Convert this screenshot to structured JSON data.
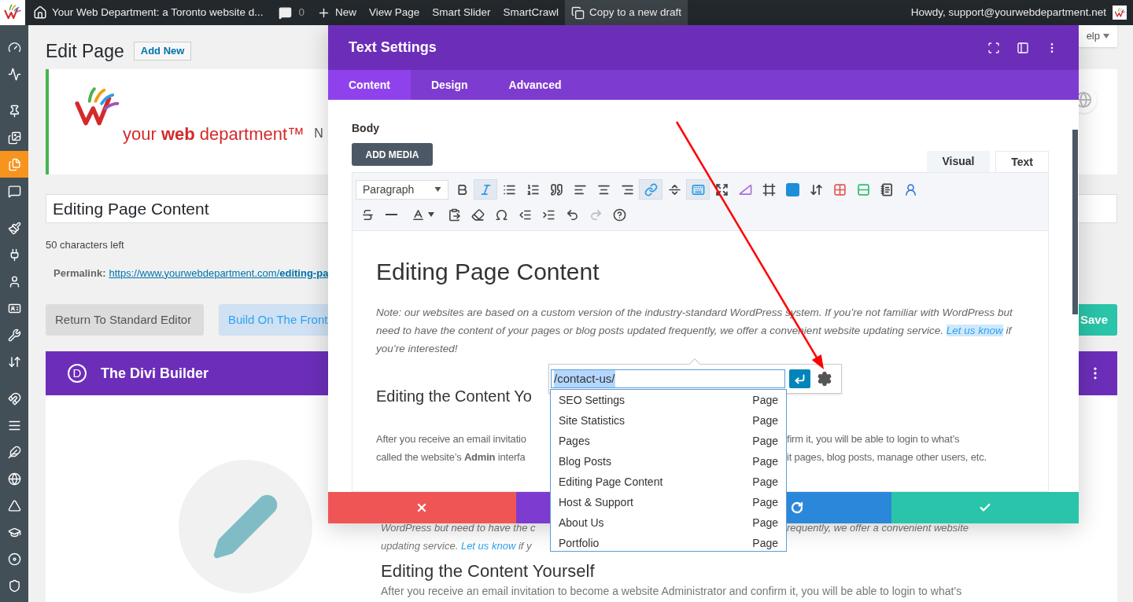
{
  "admin_bar": {
    "site_title": "Your Web Department: a Toronto website d...",
    "comments": "0",
    "items": [
      {
        "kind": "new",
        "label": "New"
      },
      {
        "kind": "link",
        "label": "View Page"
      },
      {
        "kind": "link",
        "label": "Smart Slider"
      },
      {
        "kind": "link",
        "label": "SmartCrawl"
      },
      {
        "kind": "copy",
        "label": "Copy to a new draft"
      }
    ],
    "greeting": "Howdy, support@yourwebdepartment.net"
  },
  "sidebar": {
    "items": [
      {
        "selected": false
      },
      {
        "selected": false
      },
      {
        "selected": false
      },
      {
        "selected": false
      },
      {
        "selected": true
      },
      {
        "selected": false
      },
      {
        "selected": false
      },
      {
        "selected": false
      },
      {
        "selected": false
      },
      {
        "selected": false
      },
      {
        "selected": false
      },
      {
        "selected": false
      },
      {
        "selected": false
      },
      {
        "selected": false
      },
      {
        "selected": false
      },
      {
        "selected": false
      },
      {
        "selected": false
      },
      {
        "selected": false
      },
      {
        "selected": false
      },
      {
        "selected": false
      }
    ]
  },
  "page": {
    "title": "Edit Page",
    "add_new": "Add New",
    "help_tab": "elp",
    "logo_text": "your **web** department™",
    "notice_cut_text": "N",
    "post_title": "Editing Page Content",
    "chars_left": "50 characters left",
    "permalink_label": "Permalink:",
    "permalink_url": "https://www.yourwebdepartment.com/**editing-pa**",
    "buttons": [
      {
        "kind": "default",
        "label": "Return To Standard Editor"
      },
      {
        "kind": "primary",
        "label": "Build On The Front"
      }
    ],
    "save": "Save",
    "builder_logo": "D",
    "builder_title": "The Divi Builder",
    "preview": {
      "line_1_left": "WordPress but need to have the c",
      "line_1_right": "requently, we offer a convenient website",
      "line_2_text": "updating service.",
      "line_2_link": "Let us know",
      "line_2_after": "if y",
      "heading": "Editing the Content Yourself",
      "paragraph": "After you receive an email invitation to become a website Administrator and confirm it, you will be able to login to what’s"
    }
  },
  "modal": {
    "title": "Text Settings",
    "tabs": [
      {
        "label": "Content",
        "selected": true
      },
      {
        "label": "Design",
        "selected": false
      },
      {
        "label": "Advanced",
        "selected": false
      }
    ],
    "field_label": "Body",
    "add_media": "ADD MEDIA",
    "editor_tabs": [
      {
        "label": "Visual",
        "selected": true
      },
      {
        "label": "Text",
        "selected": false
      }
    ],
    "format_select": "Paragraph",
    "toolbar_row_1": [
      {
        "active": false
      },
      {
        "active": true
      },
      {
        "active": false
      },
      {
        "active": false
      },
      {
        "active": false
      },
      {
        "active": false
      },
      {
        "active": false
      },
      {
        "active": false
      },
      {
        "active": true
      },
      {
        "active": false
      },
      {
        "active": true
      },
      {
        "active": false
      },
      {
        "active": false
      },
      {
        "active": false
      },
      {
        "active": false
      },
      {
        "active": false
      },
      {
        "active": false
      },
      {
        "active": false
      },
      {
        "active": false
      },
      {
        "active": false
      }
    ],
    "toolbar_row_2": [
      {
        "disabled": false
      },
      {
        "disabled": false
      },
      {
        "disabled": false
      },
      {
        "disabled": false
      },
      {
        "disabled": false
      },
      {
        "disabled": false
      },
      {
        "disabled": false
      },
      {
        "disabled": false
      },
      {
        "disabled": false
      },
      {
        "disabled": true
      },
      {
        "disabled": false
      }
    ],
    "content": {
      "heading": "Editing Page Content",
      "note": {
        "before": "Note: our websites are based on a custom version of the industry-standard WordPress system. If you’re not familiar with WordPress but need to have the content of your pages or blog posts updated frequently, we offer a convenient website updating service.",
        "link": "Let us know",
        "after": "if you’re interested!"
      },
      "heading_2": "Editing the Content Yo",
      "lines": [
        {
          "left": "After you receive an email invitatio",
          "right": "firm it, you will be able to login to what’s"
        },
        {
          "left": "called the website’s **Admin** interfa",
          "right": "it pages, blog posts, manage other users, etc."
        }
      ]
    },
    "footer_buttons": [
      {
        "kind": "cancel"
      },
      {
        "kind": "undo"
      },
      {
        "kind": "redo"
      },
      {
        "kind": "save"
      }
    ]
  },
  "link_popup": {
    "url": "/contact-us/",
    "results": [
      {
        "title": "SEO Settings",
        "type": "Page"
      },
      {
        "title": "Site Statistics",
        "type": "Page"
      },
      {
        "title": "Pages",
        "type": "Page"
      },
      {
        "title": "Blog Posts",
        "type": "Page"
      },
      {
        "title": "Editing Page Content",
        "type": "Page"
      },
      {
        "title": "Host & Support",
        "type": "Page"
      },
      {
        "title": "About Us",
        "type": "Page"
      },
      {
        "title": "Portfolio",
        "type": "Page"
      }
    ]
  }
}
